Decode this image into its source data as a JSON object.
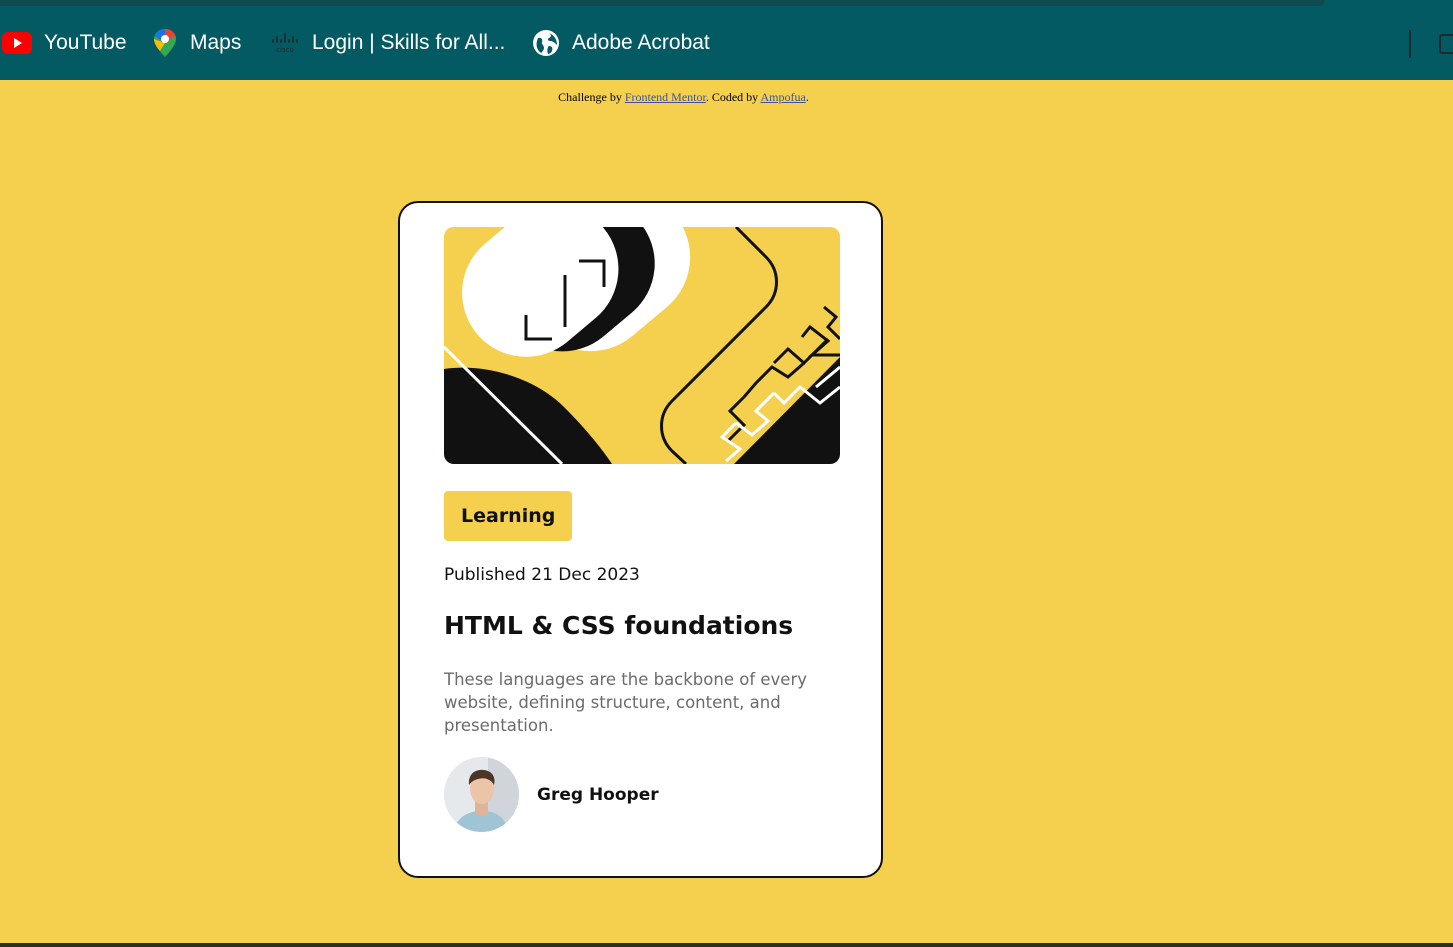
{
  "bookmarks": [
    {
      "label": "YouTube",
      "icon": "youtube-icon"
    },
    {
      "label": "Maps",
      "icon": "maps-pin-icon"
    },
    {
      "label": "Login | Skills for All...",
      "icon": "cisco-icon"
    },
    {
      "label": "Adobe Acrobat",
      "icon": "globe-icon"
    }
  ],
  "attribution": {
    "prefix": "Challenge by ",
    "link1": "Frontend Mentor",
    "middle": ". Coded by ",
    "link2": "Ampofua",
    "suffix": "."
  },
  "card": {
    "tag": "Learning",
    "published": "Published 21 Dec 2023",
    "title": "HTML & CSS foundations",
    "description": "These languages are the backbone of every website, defining structure, content, and presentation.",
    "author": "Greg Hooper"
  },
  "colors": {
    "background": "#f4d04e",
    "bookmarks_bar": "#045a62",
    "card": "#ffffff",
    "text": "#111111",
    "muted_text": "#6b6b6b",
    "link": "#3e52a3"
  }
}
